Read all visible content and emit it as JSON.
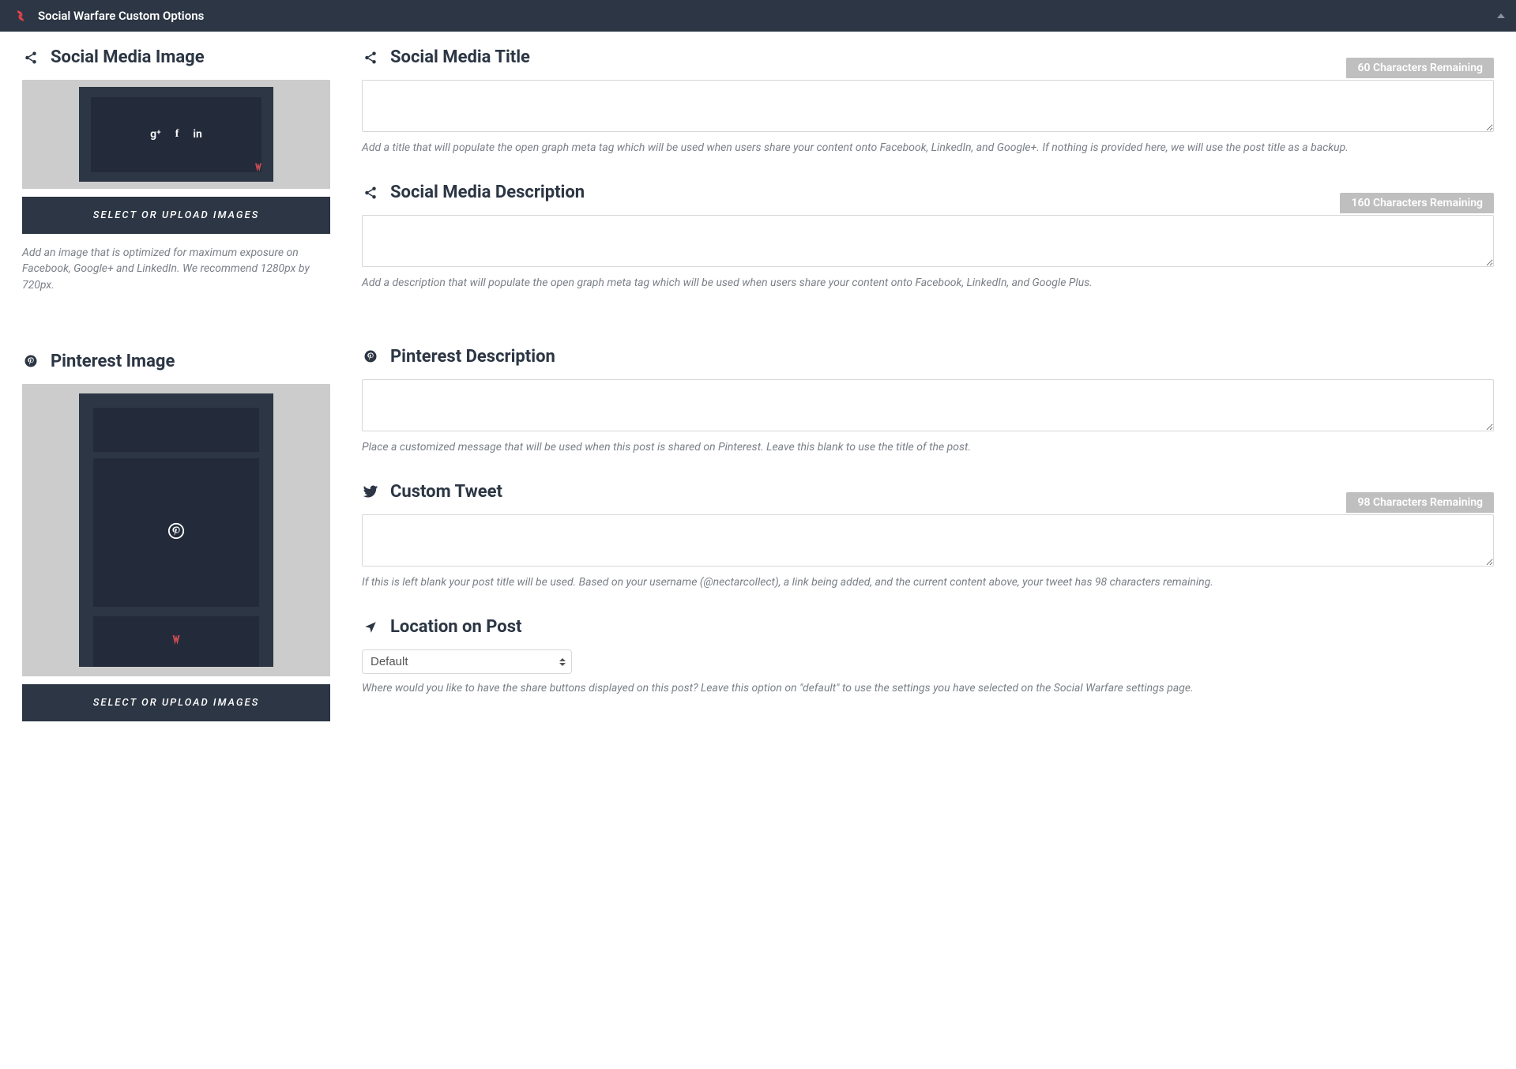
{
  "header": {
    "title": "Social Warfare Custom Options"
  },
  "left": {
    "social_image": {
      "heading": "Social Media Image",
      "button": "SELECT OR UPLOAD IMAGES",
      "helper": "Add an image that is optimized for maximum exposure on Facebook, Google+ and LinkedIn. We recommend 1280px by 720px."
    },
    "pinterest_image": {
      "heading": "Pinterest Image",
      "button": "SELECT OR UPLOAD IMAGES"
    }
  },
  "right": {
    "social_title": {
      "heading": "Social Media Title",
      "char_badge": "60 Characters Remaining",
      "helper": "Add a title that will populate the open graph meta tag which will be used when users share your content onto Facebook, LinkedIn, and Google+. If nothing is provided here, we will use the post title as a backup."
    },
    "social_description": {
      "heading": "Social Media Description",
      "char_badge": "160 Characters Remaining",
      "helper": "Add a description that will populate the open graph meta tag which will be used when users share your content onto Facebook, LinkedIn, and Google Plus."
    },
    "pinterest_description": {
      "heading": "Pinterest Description",
      "helper": "Place a customized message that will be used when this post is shared on Pinterest. Leave this blank to use the title of the post."
    },
    "custom_tweet": {
      "heading": "Custom Tweet",
      "char_badge": "98 Characters Remaining",
      "helper": "If this is left blank your post title will be used. Based on your username (@nectarcollect), a link being added, and the current content above, your tweet has 98 characters remaining."
    },
    "location": {
      "heading": "Location on Post",
      "selected": "Default",
      "helper": "Where would you like to have the share buttons displayed on this post? Leave this option on \"default\" to use the settings you have selected on the Social Warfare settings page."
    }
  }
}
